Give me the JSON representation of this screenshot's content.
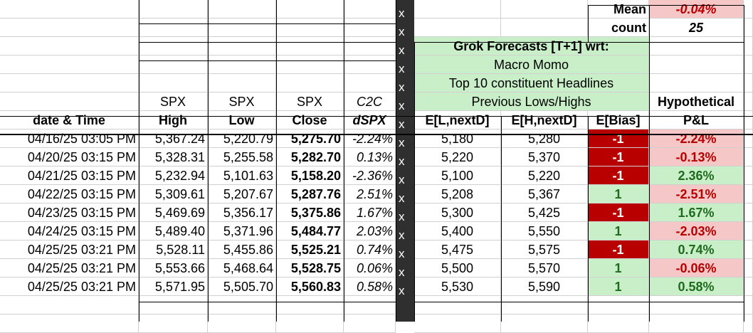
{
  "summary": {
    "mean_label": "Mean",
    "mean_value": "-0.04%",
    "count_label": "count",
    "count_value": "25"
  },
  "banner": {
    "title": "Grok Forecasts [T+1] wrt:",
    "line1": "Macro Momo",
    "line2": "Top 10 constituent Headlines",
    "line3": "Previous Lows/Highs"
  },
  "separator_mark": "x",
  "headers": {
    "top": [
      "SPX",
      "SPX",
      "SPX",
      "C2C"
    ],
    "date_time": "date & Time",
    "high": "High",
    "low": "Low",
    "close": "Close",
    "dspx": "dSPX",
    "el": "E[L,nextD]",
    "eh": "E[H,nextD]",
    "ebias": "E[Bias]",
    "hyp_top": "Hypothetical",
    "hyp_bottom": "P&L"
  },
  "rows": [
    {
      "date": "04/16/25 03:05 PM",
      "high": "5,367.24",
      "low": "5,220.79",
      "close": "5,275.70",
      "dspx": "-2.24%",
      "el": "5,180",
      "eh": "5,280",
      "bias": "-1",
      "pnl": "-2.24%"
    },
    {
      "date": "04/20/25 03:15 PM",
      "high": "5,328.31",
      "low": "5,255.58",
      "close": "5,282.70",
      "dspx": "0.13%",
      "el": "5,220",
      "eh": "5,370",
      "bias": "-1",
      "pnl": "-0.13%"
    },
    {
      "date": "04/21/25 03:15 PM",
      "high": "5,232.94",
      "low": "5,101.63",
      "close": "5,158.20",
      "dspx": "-2.36%",
      "el": "5,100",
      "eh": "5,220",
      "bias": "-1",
      "pnl": "2.36%"
    },
    {
      "date": "04/22/25 03:15 PM",
      "high": "5,309.61",
      "low": "5,207.67",
      "close": "5,287.76",
      "dspx": "2.51%",
      "el": "5,208",
      "eh": "5,367",
      "bias": "1",
      "pnl": "-2.51%"
    },
    {
      "date": "04/23/25 03:15 PM",
      "high": "5,469.69",
      "low": "5,356.17",
      "close": "5,375.86",
      "dspx": "1.67%",
      "el": "5,300",
      "eh": "5,425",
      "bias": "-1",
      "pnl": "1.67%"
    },
    {
      "date": "04/24/25 03:15 PM",
      "high": "5,489.40",
      "low": "5,371.96",
      "close": "5,484.77",
      "dspx": "2.03%",
      "el": "5,400",
      "eh": "5,550",
      "bias": "1",
      "pnl": "-2.03%"
    },
    {
      "date": "04/25/25 03:21 PM",
      "high": "5,528.11",
      "low": "5,455.86",
      "close": "5,525.21",
      "dspx": "0.74%",
      "el": "5,475",
      "eh": "5,575",
      "bias": "-1",
      "pnl": "0.74%"
    },
    {
      "date": "04/25/25 03:21 PM",
      "high": "5,553.66",
      "low": "5,468.64",
      "close": "5,528.75",
      "dspx": "0.06%",
      "el": "5,500",
      "eh": "5,570",
      "bias": "1",
      "pnl": "-0.06%"
    },
    {
      "date": "04/25/25 03:21 PM",
      "high": "5,571.95",
      "low": "5,505.70",
      "close": "5,560.83",
      "dspx": "0.58%",
      "el": "5,530",
      "eh": "5,590",
      "bias": "1",
      "pnl": "0.58%"
    }
  ],
  "colors": {
    "negative_fill": "#b80000",
    "positive_fill": "#c9efc9",
    "loss_fill": "#f6c7c7",
    "separator": "#2f2f2f"
  }
}
